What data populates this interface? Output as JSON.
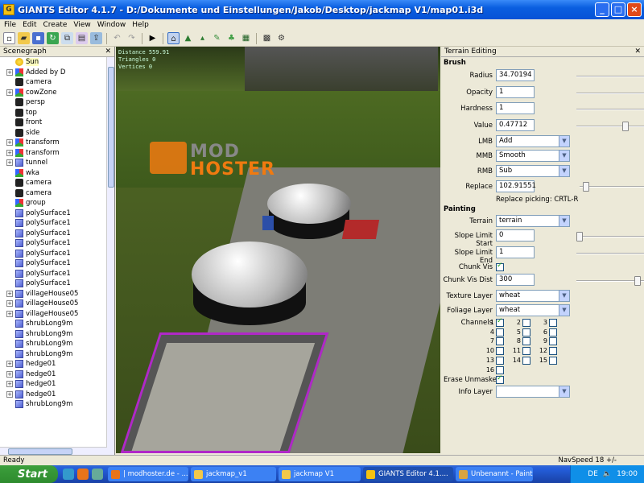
{
  "window": {
    "title": "GIANTS Editor 4.1.7 - D:/Dokumente und Einstellungen/Jakob/Desktop/jackmap V1/map01.i3d",
    "app_icon": "giants-app-icon"
  },
  "menu": [
    "File",
    "Edit",
    "Create",
    "View",
    "Window",
    "Help"
  ],
  "toolbar_icons": [
    "new-icon",
    "open-icon",
    "save-icon",
    "refresh-icon",
    "copy-icon",
    "paste-icon",
    "export-icon",
    "undo-icon",
    "redo-icon",
    "play-icon",
    "home-icon",
    "terrain-icon",
    "foliage-icon",
    "paint-icon",
    "grass-icon",
    "tree-icon",
    "decal-icon",
    "settings-icon"
  ],
  "scenegraph": {
    "title": "Scenegraph",
    "items": [
      {
        "label": "Sun",
        "icon": "light",
        "exp": false,
        "sel": true
      },
      {
        "label": "Added by D",
        "icon": "tg",
        "exp": true
      },
      {
        "label": "camera",
        "icon": "cam",
        "exp": false
      },
      {
        "label": "cowZone",
        "icon": "tg",
        "exp": true
      },
      {
        "label": "persp",
        "icon": "cam",
        "exp": false
      },
      {
        "label": "top",
        "icon": "cam",
        "exp": false
      },
      {
        "label": "front",
        "icon": "cam",
        "exp": false
      },
      {
        "label": "side",
        "icon": "cam",
        "exp": false
      },
      {
        "label": "transform",
        "icon": "tg",
        "exp": true
      },
      {
        "label": "transform",
        "icon": "tg",
        "exp": true
      },
      {
        "label": "tunnel",
        "icon": "mesh",
        "exp": true
      },
      {
        "label": "wka",
        "icon": "tg",
        "exp": false
      },
      {
        "label": "camera",
        "icon": "cam",
        "exp": false
      },
      {
        "label": "camera",
        "icon": "cam",
        "exp": false
      },
      {
        "label": "group",
        "icon": "tg",
        "exp": false
      },
      {
        "label": "polySurface1",
        "icon": "mesh",
        "exp": false
      },
      {
        "label": "polySurface1",
        "icon": "mesh",
        "exp": false
      },
      {
        "label": "polySurface1",
        "icon": "mesh",
        "exp": false
      },
      {
        "label": "polySurface1",
        "icon": "mesh",
        "exp": false
      },
      {
        "label": "polySurface1",
        "icon": "mesh",
        "exp": false
      },
      {
        "label": "polySurface1",
        "icon": "mesh",
        "exp": false
      },
      {
        "label": "polySurface1",
        "icon": "mesh",
        "exp": false
      },
      {
        "label": "polySurface1",
        "icon": "mesh",
        "exp": false
      },
      {
        "label": "villageHouse05",
        "icon": "mesh",
        "exp": true
      },
      {
        "label": "villageHouse05",
        "icon": "mesh",
        "exp": true
      },
      {
        "label": "villageHouse05",
        "icon": "mesh",
        "exp": true
      },
      {
        "label": "shrubLong9m",
        "icon": "mesh",
        "exp": false
      },
      {
        "label": "shrubLong9m",
        "icon": "mesh",
        "exp": false
      },
      {
        "label": "shrubLong9m",
        "icon": "mesh",
        "exp": false
      },
      {
        "label": "shrubLong9m",
        "icon": "mesh",
        "exp": false
      },
      {
        "label": "hedge01",
        "icon": "mesh",
        "exp": true
      },
      {
        "label": "hedge01",
        "icon": "mesh",
        "exp": true
      },
      {
        "label": "hedge01",
        "icon": "mesh",
        "exp": true
      },
      {
        "label": "hedge01",
        "icon": "mesh",
        "exp": true
      },
      {
        "label": "shrubLong9m",
        "icon": "mesh",
        "exp": false
      }
    ]
  },
  "viewport": {
    "stats": [
      "Distance 559.91",
      "Triangles 0",
      "Vertices 0"
    ],
    "watermark_top": "MOD",
    "watermark_bottom": "HOSTER"
  },
  "terrain": {
    "title": "Terrain Editing",
    "brush_header": "Brush",
    "radius_label": "Radius",
    "radius": "34.70194",
    "opacity_label": "Opacity",
    "opacity": "1",
    "hardness_label": "Hardness",
    "hardness": "1",
    "value_label": "Value",
    "value": "0.47712",
    "lmb_label": "LMB",
    "lmb": "Add",
    "mmb_label": "MMB",
    "mmb": "Smooth",
    "rmb_label": "RMB",
    "rmb": "Sub",
    "replace_label": "Replace",
    "replace": "102.91551",
    "replace_picking": "Replace picking: CRTL-R",
    "painting_header": "Painting",
    "terrain_label": "Terrain",
    "terrain_value": "terrain",
    "slope_start_label": "Slope Limit Start",
    "slope_start": "0",
    "slope_end_label": "Slope Limit End",
    "slope_end": "1",
    "chunk_vis_label": "Chunk Vis",
    "chunk_vis_dist_label": "Chunk Vis Dist",
    "chunk_vis_dist": "300",
    "texture_layer_label": "Texture Layer",
    "texture_layer": "wheat",
    "foliage_layer_label": "Foliage Layer",
    "foliage_layer": "wheat",
    "channels_label": "Channels",
    "channels": [
      "1",
      "2",
      "3",
      "4",
      "5",
      "6",
      "7",
      "8",
      "9",
      "10",
      "11",
      "12",
      "13",
      "14",
      "15",
      "16"
    ],
    "channel_checked": [
      true,
      false,
      false,
      false,
      false,
      false,
      false,
      false,
      false,
      false,
      false,
      false,
      false,
      false,
      false,
      false
    ],
    "erase_unmasked_label": "Erase Unmasked",
    "info_layer_label": "Info Layer",
    "info_layer": ""
  },
  "status": {
    "left": "Ready",
    "right": "NavSpeed 18 +/-"
  },
  "taskbar": {
    "start": "Start",
    "tasks": [
      {
        "label": "| modhoster.de - ...",
        "color": "#e8741a"
      },
      {
        "label": "jackmap_v1",
        "color": "#f1c84a"
      },
      {
        "label": "jackmap V1",
        "color": "#f1c84a"
      },
      {
        "label": "GIANTS Editor 4.1....",
        "color": "#f5c211"
      },
      {
        "label": "Unbenannt - Paint",
        "color": "#d9a441"
      }
    ],
    "lang": "DE",
    "clock": "19:00"
  }
}
